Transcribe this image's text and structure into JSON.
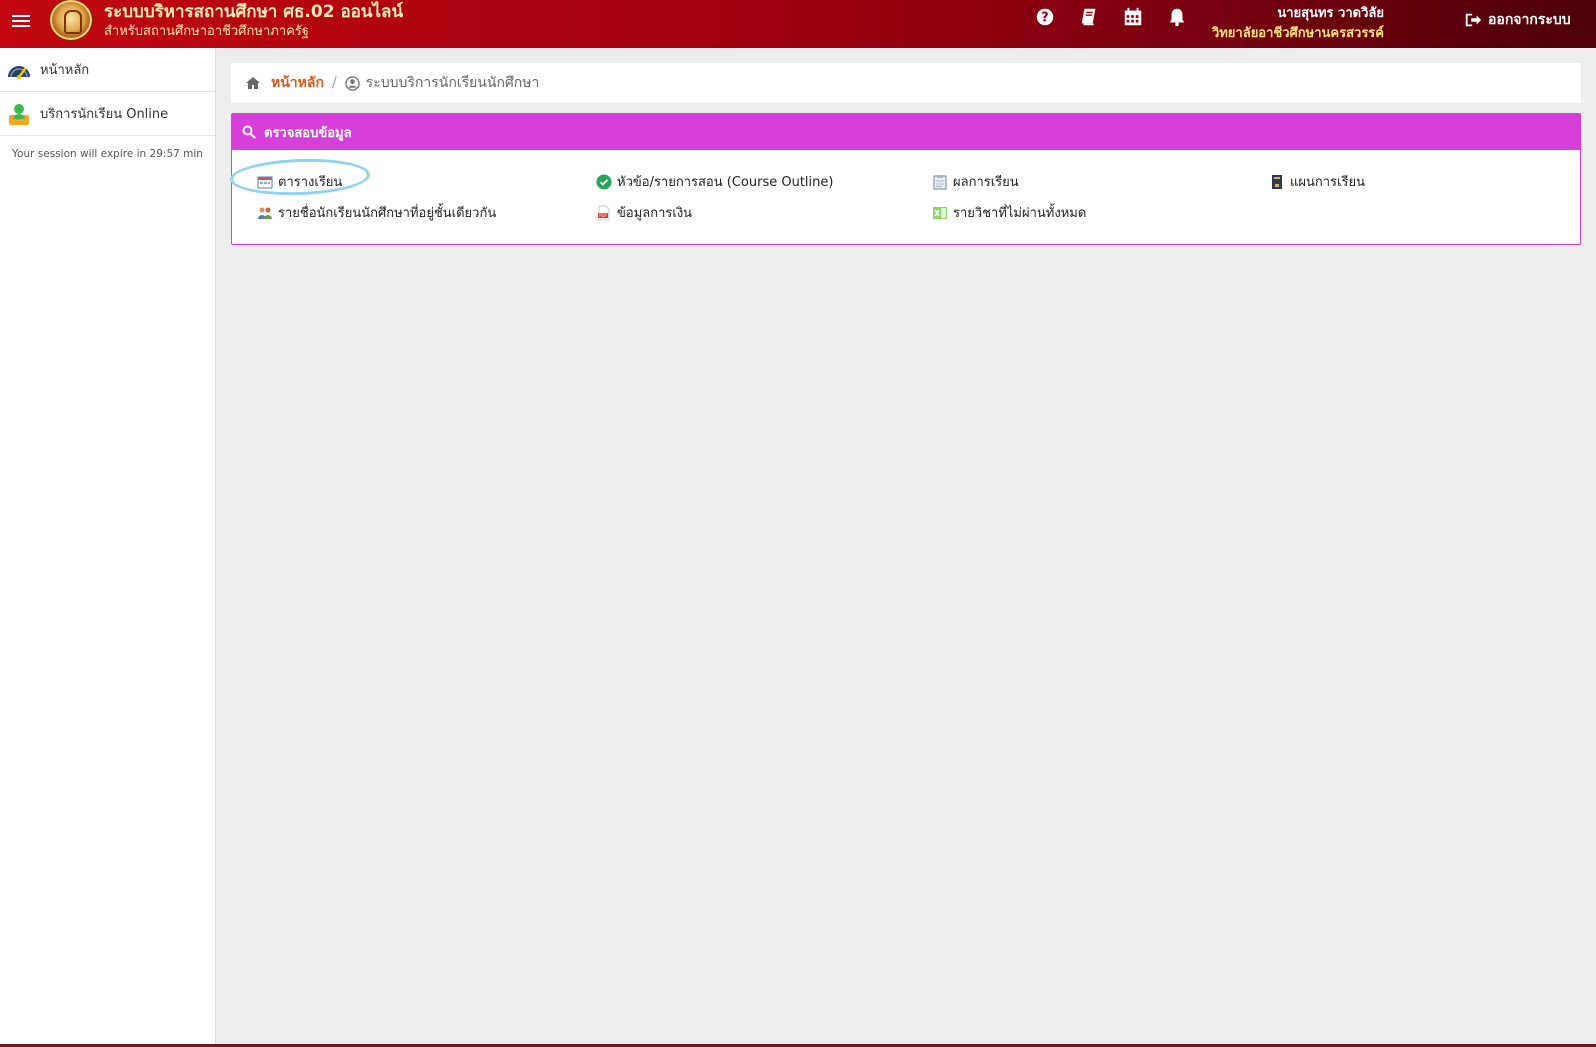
{
  "header": {
    "title": "ระบบบริหารสถานศึกษา ศธ.02 ออนไลน์",
    "subtitle": "สำหรับสถานศึกษาอาชีวศึกษาภาครัฐ",
    "icons": [
      "question-circle-icon",
      "book-icon",
      "calendar-icon",
      "bell-icon"
    ],
    "user_name": "นายสุนทร วาดวิลัย",
    "user_org": "วิทยาลัยอาชีวศึกษานครสวรรค์",
    "logout_label": "ออกจากระบบ"
  },
  "sidebar": {
    "items": [
      {
        "label": "หน้าหลัก",
        "icon": "dashboard-gauge-icon"
      },
      {
        "label": "บริการนักเรียน Online",
        "icon": "student-user-icon"
      }
    ],
    "session_text": "Your session will expire in 29:57 min"
  },
  "breadcrumb": {
    "home": "หน้าหลัก",
    "separator": "/",
    "current": "ระบบบริการนักเรียนนักศึกษา"
  },
  "panel": {
    "title": "ตรวจสอบข้อมูล",
    "color": "#d63fd9",
    "items": [
      {
        "label": "ตารางเรียน",
        "icon": "timetable-icon"
      },
      {
        "label": "หัวข้อ/รายการสอน (Course Outline)",
        "icon": "check-circle-icon"
      },
      {
        "label": "ผลการเรียน",
        "icon": "clipboard-icon"
      },
      {
        "label": "แผนการเรียน",
        "icon": "notebook-icon"
      },
      {
        "label": "รายชื่อนักเรียนนักศึกษาที่อยู่ชั้นเดียวกัน",
        "icon": "classmates-icon"
      },
      {
        "label": "ข้อมูลการเงิน",
        "icon": "pdf-icon"
      },
      {
        "label": "รายวิชาที่ไม่ผ่านทั้งหมด",
        "icon": "excel-icon"
      }
    ]
  }
}
